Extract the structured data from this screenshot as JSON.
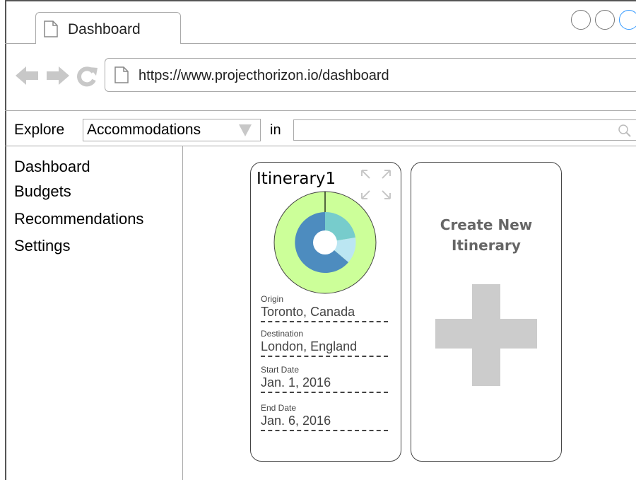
{
  "browser": {
    "tab_title": "Dashboard",
    "url": "https://www.projecthorizon.io/dashboard",
    "icons": [
      "document-icon",
      "back-arrow-icon",
      "forward-arrow-icon",
      "reload-icon",
      "search-icon",
      "expand-icon",
      "plus-icon"
    ]
  },
  "explore": {
    "label": "Explore",
    "selected": "Accommodations",
    "in_label": "in",
    "search_value": ""
  },
  "sidebar": {
    "items": [
      {
        "label": "Dashboard"
      },
      {
        "label": "Budgets"
      },
      {
        "label": "Recommendations"
      },
      {
        "label": "Settings"
      }
    ]
  },
  "itinerary_card": {
    "title": "Itinerary1",
    "fields": [
      {
        "label": "Origin",
        "value": "Toronto, Canada"
      },
      {
        "label": "Destination",
        "value": "London, England"
      },
      {
        "label": "Start Date",
        "value": "Jan. 1, 2016"
      },
      {
        "label": "End Date",
        "value": "Jan. 6, 2016"
      }
    ]
  },
  "create_card": {
    "line1": "Create New",
    "line2": "Itinerary"
  },
  "colors": {
    "donut_outer": "#ccff99",
    "donut_blue": "#4d8cbf",
    "donut_teal": "#77cccc",
    "donut_light": "#bbe6f2",
    "plus": "#cccccc",
    "window_button_active": "#3399ff"
  }
}
